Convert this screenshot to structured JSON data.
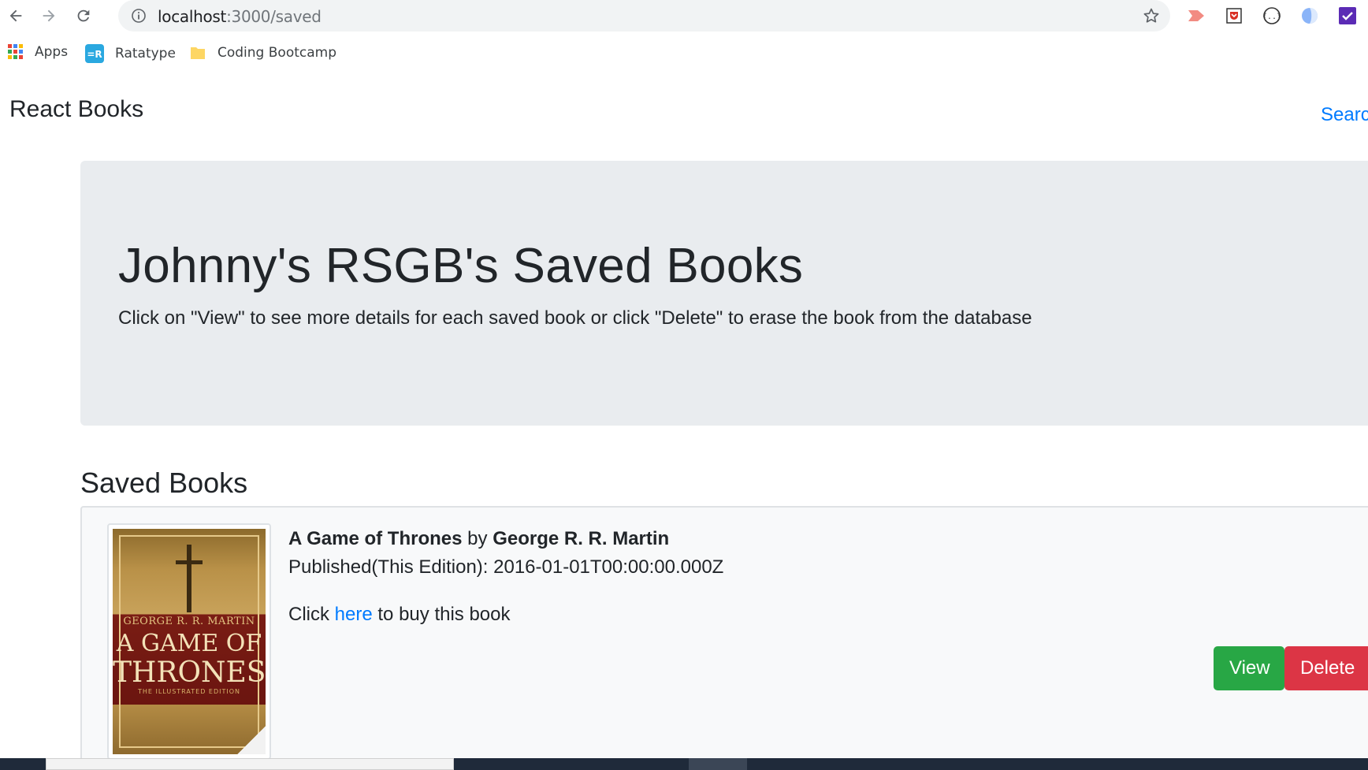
{
  "browser": {
    "url_host": "localhost",
    "url_path": ":3000/saved",
    "bookmarks": [
      {
        "label": "Apps",
        "icon": "apps-grid-icon"
      },
      {
        "label": "Ratatype",
        "icon": "ratatype-icon"
      },
      {
        "label": "Coding Bootcamp",
        "icon": "folder-icon"
      }
    ],
    "extensions": [
      "video-extension-icon",
      "pocket-extension-icon",
      "json-extension-icon",
      "globe-extension-icon",
      "check-extension-icon"
    ]
  },
  "navbar": {
    "brand": "React Books",
    "search_link": "Search"
  },
  "jumbotron": {
    "title": "Johnny's RSGB's Saved Books",
    "subtitle": "Click on \"View\" to see more details for each saved book or click \"Delete\" to erase the book from the database"
  },
  "saved": {
    "heading": "Saved Books",
    "books": [
      {
        "title": "A Game of Thrones",
        "by": "by",
        "author": "George R. R. Martin",
        "published": "Published(This Edition): 2016-01-01T00:00:00.000Z",
        "buy_prefix": "Click",
        "buy_link": "here",
        "buy_suffix": "to buy this book",
        "cover_author": "GEORGE R. R. MARTIN",
        "cover_title_1": "A GAME OF",
        "cover_title_2": "THRONES",
        "cover_edition": "THE ILLUSTRATED EDITION",
        "view_label": "View",
        "delete_label": "Delete"
      }
    ]
  },
  "colors": {
    "primary": "#007bff",
    "success": "#28a745",
    "danger": "#dc3545",
    "jumbotron_bg": "#e9ecef"
  }
}
